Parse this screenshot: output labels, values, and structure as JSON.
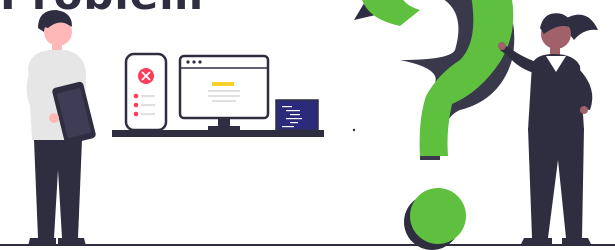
{
  "heading": {
    "text": "Problem"
  },
  "colors": {
    "accent_green": "#5fbf3f",
    "dark_navy": "#2f2e41",
    "alert_red": "#ff3d5a",
    "yellow_bar": "#f7d02c",
    "terminal_blue": "#2c2a7a",
    "shirt_gray": "#e6e6e6"
  },
  "icons": {
    "phone_badge": "close-icon",
    "question_mark": "question-mark-icon"
  }
}
